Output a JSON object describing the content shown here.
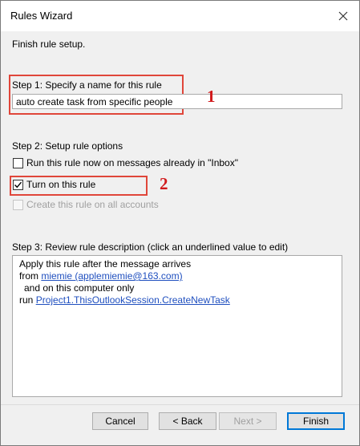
{
  "window": {
    "title": "Rules Wizard"
  },
  "intro": "Finish rule setup.",
  "step1": {
    "label": "Step 1: Specify a name for this rule",
    "name_value": "auto create task from specific people"
  },
  "step2": {
    "label": "Step 2: Setup rule options",
    "options": [
      {
        "label": "Run this rule now on messages already in \"Inbox\"",
        "checked": false,
        "enabled": true
      },
      {
        "label": "Turn on this rule",
        "checked": true,
        "enabled": true
      },
      {
        "label": "Create this rule on all accounts",
        "checked": false,
        "enabled": false
      }
    ]
  },
  "step3": {
    "label": "Step 3: Review rule description (click an underlined value to edit)",
    "line1": "Apply this rule after the message arrives",
    "line2_prefix": "from ",
    "line2_link": "miemie (applemiemie@163.com)",
    "line3": "and on this computer only",
    "line4_prefix": "run ",
    "line4_link": "Project1.ThisOutlookSession.CreateNewTask"
  },
  "annotations": {
    "marker1": "1",
    "marker2": "2"
  },
  "buttons": {
    "cancel": "Cancel",
    "back": "< Back",
    "next": "Next >",
    "finish": "Finish"
  },
  "colors": {
    "highlight_box": "#e0463a",
    "marker_number": "#d1191b",
    "link": "#1f4fbf",
    "primary_button_border": "#0078d7"
  }
}
